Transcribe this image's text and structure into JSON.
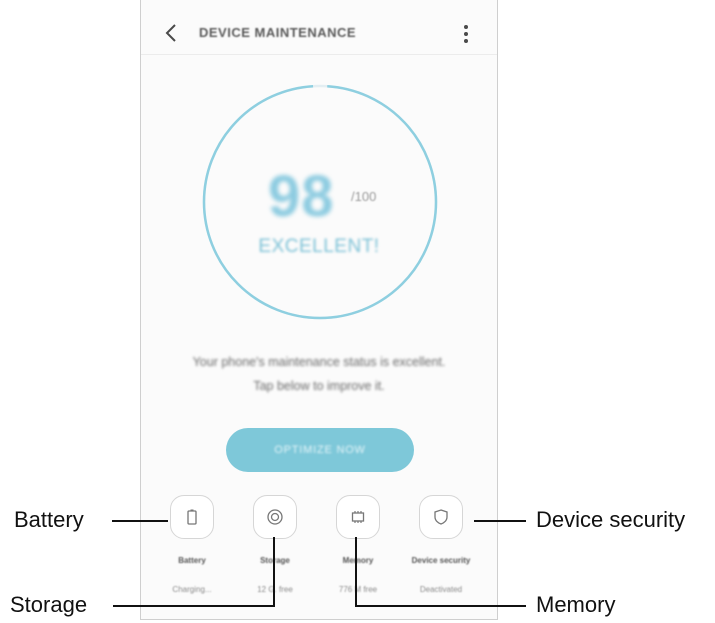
{
  "appbar": {
    "title": "DEVICE MAINTENANCE",
    "back_icon": "chevron-left-icon",
    "more_icon": "more-vertical-icon"
  },
  "gauge": {
    "score": "98",
    "max": "/100",
    "status": "EXCELLENT!",
    "level": 0.98,
    "ring_color": "#8ecfe0"
  },
  "message": {
    "line1": "Your phone's maintenance status is excellent.",
    "line2": "Tap below to improve it."
  },
  "optimize_button": {
    "label": "OPTIMIZE NOW",
    "color": "#7ec8d9"
  },
  "tiles": [
    {
      "label": "Battery",
      "sub": "Charging...",
      "icon": "battery-icon"
    },
    {
      "label": "Storage",
      "sub": "12 G. free",
      "icon": "storage-icon"
    },
    {
      "label": "Memory",
      "sub": "776 M free",
      "icon": "memory-chip-icon"
    },
    {
      "label": "Device security",
      "sub": "Deactivated",
      "icon": "shield-icon"
    }
  ],
  "callouts": {
    "battery": "Battery",
    "storage": "Storage",
    "memory": "Memory",
    "device_security": "Device security"
  }
}
